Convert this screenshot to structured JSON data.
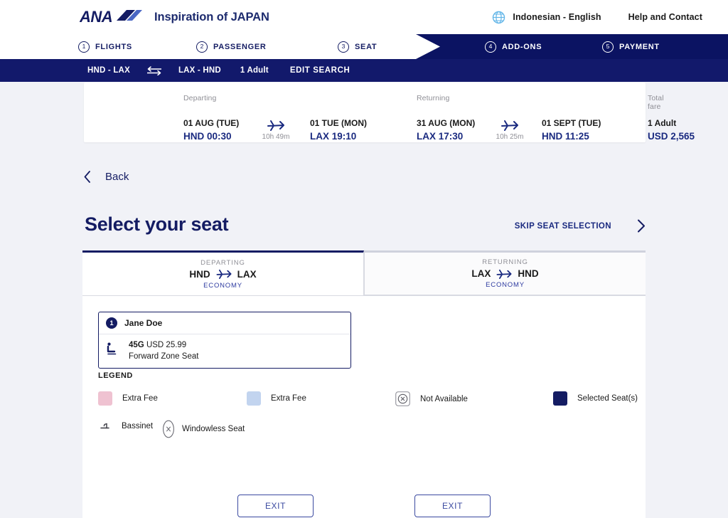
{
  "header": {
    "logo_alt": "ANA",
    "tagline": "Inspiration of JAPAN",
    "globe_icon": "globe-icon",
    "language": "Indonesian - English",
    "help": "Help and Contact",
    "brand_navy": "#141c63",
    "accent_blue": "#1a2a80"
  },
  "stepper": {
    "steps": [
      {
        "num": "1",
        "label": "FLIGHTS",
        "state": "light"
      },
      {
        "num": "2",
        "label": "PASSENGER",
        "state": "light"
      },
      {
        "num": "3",
        "label": "SEAT",
        "state": "light"
      },
      {
        "num": "4",
        "label": "ADD-ONS",
        "state": "dark"
      },
      {
        "num": "5",
        "label": "PAYMENT",
        "state": "dark"
      }
    ]
  },
  "searchbar": {
    "route_out": "HND - LAX",
    "swap_icon": "round-trip-arrows-icon",
    "route_back": "LAX -  HND",
    "passengers": "1 Adult",
    "edit": "EDIT SEARCH"
  },
  "summary": {
    "departing": {
      "label": "Departing",
      "from_date": "01 AUG (TUE)",
      "from_port": "HND 00:30",
      "duration": "10h 49m",
      "to_date": "01 TUE (MON)",
      "to_port": "LAX 19:10"
    },
    "returning": {
      "label": "Returning",
      "from_date": "31 AUG (MON)",
      "from_port": "LAX 17:30",
      "duration": "10h 25m",
      "to_date": "01 SEPT (TUE)",
      "to_port": "HND 11:25"
    },
    "fare": {
      "label": "Total fare",
      "pax": "1 Adult",
      "amount": "USD  2,565"
    }
  },
  "back": {
    "label": "Back",
    "icon": "chevron-left-icon"
  },
  "page": {
    "title": "Select your seat",
    "skip_label": "SKIP SEAT SELECTION",
    "skip_icon": "chevron-right-icon"
  },
  "tabs": [
    {
      "direction": "DEPARTING",
      "origin": "HND",
      "destination": "LAX",
      "cabin": "ECONOMY",
      "active": true
    },
    {
      "direction": "RETURNING",
      "origin": "LAX",
      "destination": "HND",
      "cabin": "ECONOMY",
      "active": false
    }
  ],
  "passenger_card": {
    "badge": "1",
    "name": "Jane Doe",
    "seat_icon": "seated-passenger-icon",
    "seat_code": "45G",
    "seat_price": "USD 25.99",
    "seat_type": "Forward Zone Seat"
  },
  "legend": {
    "title": "LEGEND",
    "items": [
      {
        "label": "Extra Fee",
        "swatch": "#efc2d1",
        "icon": "color-swatch"
      },
      {
        "label": "Extra Fee",
        "swatch": "#c2d4ef",
        "icon": "color-swatch"
      },
      {
        "label": "Not Available",
        "icon": "circled-x-icon"
      },
      {
        "label": "Selected Seat(s)",
        "swatch": "#141c63",
        "icon": "color-swatch"
      },
      {
        "label": "Bassinet",
        "icon": "bassinet-icon"
      },
      {
        "label": "Windowless Seat",
        "icon": "oval-x-icon"
      }
    ]
  },
  "footer": {
    "exit_left": "EXIT",
    "exit_right": "EXIT"
  }
}
